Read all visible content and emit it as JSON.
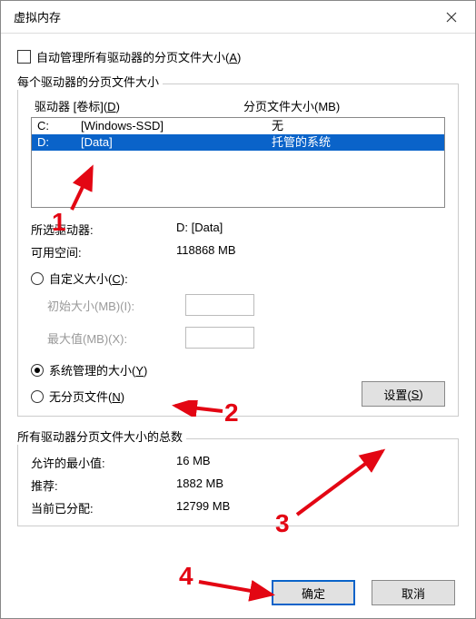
{
  "window": {
    "title": "虚拟内存"
  },
  "autoManage": {
    "label_pre": "自动管理所有驱动器的分页文件大小(",
    "label_key": "A",
    "label_post": ")"
  },
  "perDrive": {
    "group_label": "每个驱动器的分页文件大小",
    "header_drive_pre": "驱动器 [卷标](",
    "header_drive_key": "D",
    "header_drive_post": ")",
    "header_paging": "分页文件大小(MB)",
    "rows": [
      {
        "letter": "C:",
        "label": "[Windows-SSD]",
        "paging": "无"
      },
      {
        "letter": "D:",
        "label": "[Data]",
        "paging": "托管的系统"
      }
    ],
    "selected_label": "所选驱动器:",
    "selected_value": "D:   [Data]",
    "space_label": "可用空间:",
    "space_value": "118868 MB",
    "radio_custom_pre": "自定义大小(",
    "radio_custom_key": "C",
    "radio_custom_post": "):",
    "init_label_pre": "初始大小(MB)(",
    "init_label_key": "I",
    "init_label_post": "):",
    "max_label_pre": "最大值(MB)(",
    "max_label_key": "X",
    "max_label_post": "):",
    "radio_system_pre": "系统管理的大小(",
    "radio_system_key": "Y",
    "radio_system_post": ")",
    "radio_none_pre": "无分页文件(",
    "radio_none_key": "N",
    "radio_none_post": ")",
    "set_btn_pre": "设置(",
    "set_btn_key": "S",
    "set_btn_post": ")"
  },
  "totals": {
    "group_label": "所有驱动器分页文件大小的总数",
    "min_label": "允许的最小值:",
    "min_value": "16 MB",
    "rec_label": "推荐:",
    "rec_value": "1882 MB",
    "cur_label": "当前已分配:",
    "cur_value": "12799 MB"
  },
  "buttons": {
    "ok": "确定",
    "cancel": "取消"
  },
  "annotations": {
    "n1": "1",
    "n2": "2",
    "n3": "3",
    "n4": "4"
  }
}
